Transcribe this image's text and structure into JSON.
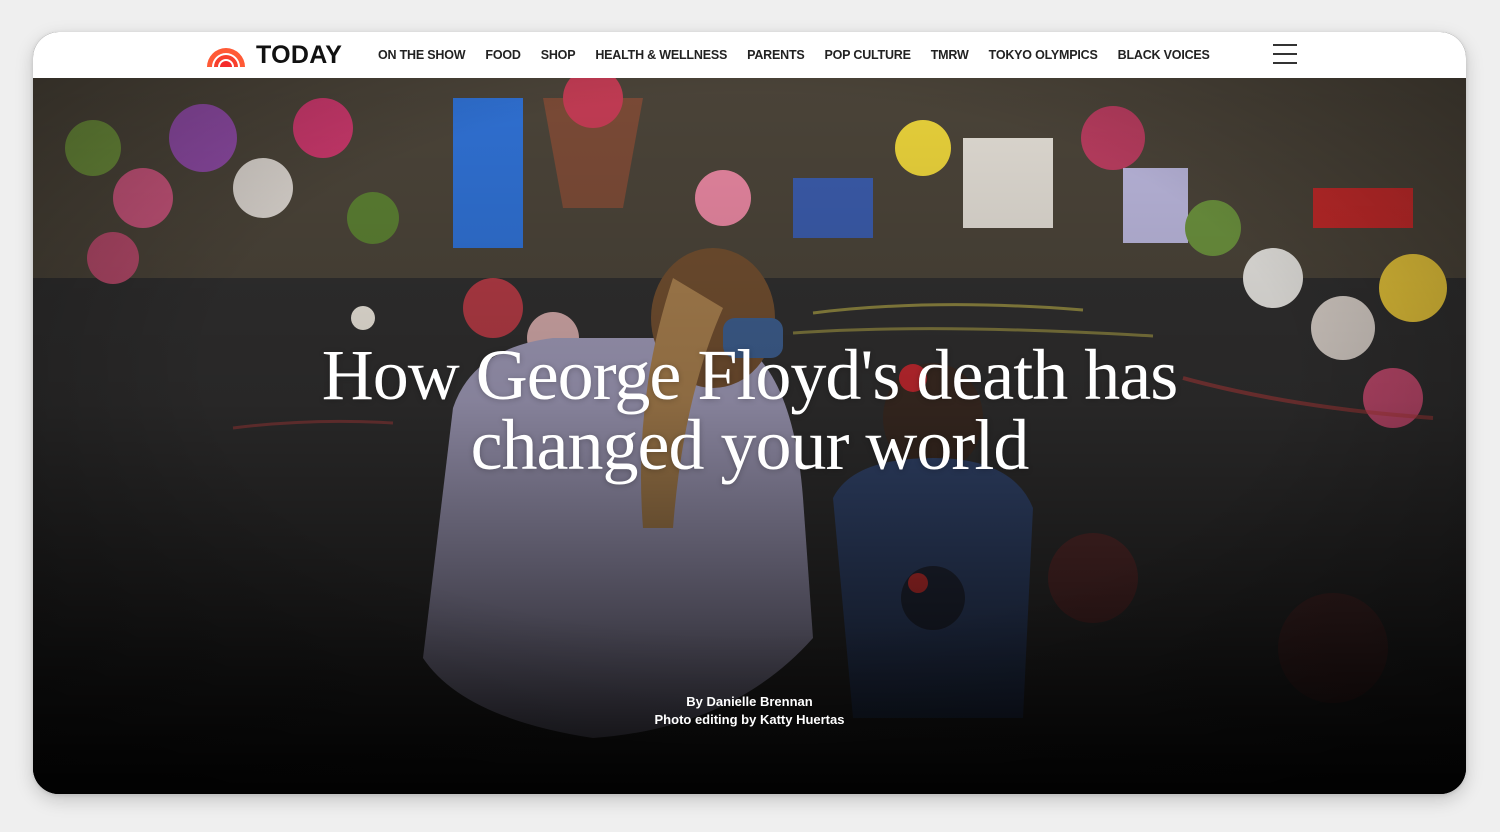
{
  "brand": {
    "name": "TODAY",
    "logo_icon": "rainbow-arc-icon",
    "logo_colors": [
      "#ff5a36",
      "#fa3c2b",
      "#f72d2d"
    ]
  },
  "nav": {
    "items": [
      {
        "label": "ON THE SHOW"
      },
      {
        "label": "FOOD"
      },
      {
        "label": "SHOP"
      },
      {
        "label": "HEALTH & WELLNESS"
      },
      {
        "label": "PARENTS"
      },
      {
        "label": "POP CULTURE"
      },
      {
        "label": "TMRW"
      },
      {
        "label": "TOKYO OLYMPICS"
      },
      {
        "label": "BLACK VOICES"
      }
    ],
    "menu_icon": "hamburger-menu-icon"
  },
  "article": {
    "headline_line1": "How George Floyd's death has",
    "headline_line2": "changed your world",
    "byline": "By Danielle Brennan",
    "photo_credit": "Photo editing by Katty Huertas",
    "hero_image": "memorial-street-photo"
  }
}
